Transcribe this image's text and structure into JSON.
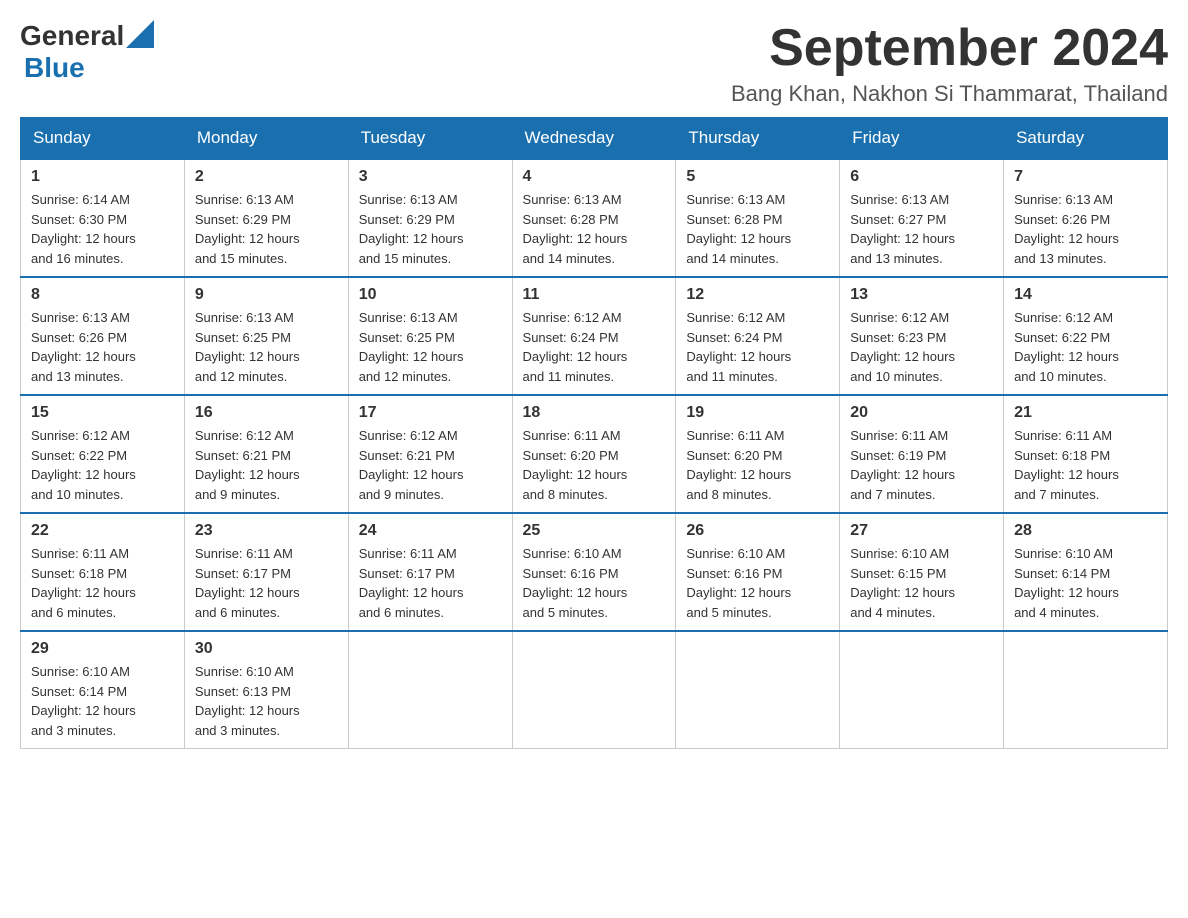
{
  "header": {
    "logo": {
      "general": "General",
      "blue": "Blue"
    },
    "title": "September 2024",
    "location": "Bang Khan, Nakhon Si Thammarat, Thailand"
  },
  "calendar": {
    "days_of_week": [
      "Sunday",
      "Monday",
      "Tuesday",
      "Wednesday",
      "Thursday",
      "Friday",
      "Saturday"
    ],
    "weeks": [
      [
        {
          "day": "1",
          "sunrise": "6:14 AM",
          "sunset": "6:30 PM",
          "daylight": "12 hours and 16 minutes."
        },
        {
          "day": "2",
          "sunrise": "6:13 AM",
          "sunset": "6:29 PM",
          "daylight": "12 hours and 15 minutes."
        },
        {
          "day": "3",
          "sunrise": "6:13 AM",
          "sunset": "6:29 PM",
          "daylight": "12 hours and 15 minutes."
        },
        {
          "day": "4",
          "sunrise": "6:13 AM",
          "sunset": "6:28 PM",
          "daylight": "12 hours and 14 minutes."
        },
        {
          "day": "5",
          "sunrise": "6:13 AM",
          "sunset": "6:28 PM",
          "daylight": "12 hours and 14 minutes."
        },
        {
          "day": "6",
          "sunrise": "6:13 AM",
          "sunset": "6:27 PM",
          "daylight": "12 hours and 13 minutes."
        },
        {
          "day": "7",
          "sunrise": "6:13 AM",
          "sunset": "6:26 PM",
          "daylight": "12 hours and 13 minutes."
        }
      ],
      [
        {
          "day": "8",
          "sunrise": "6:13 AM",
          "sunset": "6:26 PM",
          "daylight": "12 hours and 13 minutes."
        },
        {
          "day": "9",
          "sunrise": "6:13 AM",
          "sunset": "6:25 PM",
          "daylight": "12 hours and 12 minutes."
        },
        {
          "day": "10",
          "sunrise": "6:13 AM",
          "sunset": "6:25 PM",
          "daylight": "12 hours and 12 minutes."
        },
        {
          "day": "11",
          "sunrise": "6:12 AM",
          "sunset": "6:24 PM",
          "daylight": "12 hours and 11 minutes."
        },
        {
          "day": "12",
          "sunrise": "6:12 AM",
          "sunset": "6:24 PM",
          "daylight": "12 hours and 11 minutes."
        },
        {
          "day": "13",
          "sunrise": "6:12 AM",
          "sunset": "6:23 PM",
          "daylight": "12 hours and 10 minutes."
        },
        {
          "day": "14",
          "sunrise": "6:12 AM",
          "sunset": "6:22 PM",
          "daylight": "12 hours and 10 minutes."
        }
      ],
      [
        {
          "day": "15",
          "sunrise": "6:12 AM",
          "sunset": "6:22 PM",
          "daylight": "12 hours and 10 minutes."
        },
        {
          "day": "16",
          "sunrise": "6:12 AM",
          "sunset": "6:21 PM",
          "daylight": "12 hours and 9 minutes."
        },
        {
          "day": "17",
          "sunrise": "6:12 AM",
          "sunset": "6:21 PM",
          "daylight": "12 hours and 9 minutes."
        },
        {
          "day": "18",
          "sunrise": "6:11 AM",
          "sunset": "6:20 PM",
          "daylight": "12 hours and 8 minutes."
        },
        {
          "day": "19",
          "sunrise": "6:11 AM",
          "sunset": "6:20 PM",
          "daylight": "12 hours and 8 minutes."
        },
        {
          "day": "20",
          "sunrise": "6:11 AM",
          "sunset": "6:19 PM",
          "daylight": "12 hours and 7 minutes."
        },
        {
          "day": "21",
          "sunrise": "6:11 AM",
          "sunset": "6:18 PM",
          "daylight": "12 hours and 7 minutes."
        }
      ],
      [
        {
          "day": "22",
          "sunrise": "6:11 AM",
          "sunset": "6:18 PM",
          "daylight": "12 hours and 6 minutes."
        },
        {
          "day": "23",
          "sunrise": "6:11 AM",
          "sunset": "6:17 PM",
          "daylight": "12 hours and 6 minutes."
        },
        {
          "day": "24",
          "sunrise": "6:11 AM",
          "sunset": "6:17 PM",
          "daylight": "12 hours and 6 minutes."
        },
        {
          "day": "25",
          "sunrise": "6:10 AM",
          "sunset": "6:16 PM",
          "daylight": "12 hours and 5 minutes."
        },
        {
          "day": "26",
          "sunrise": "6:10 AM",
          "sunset": "6:16 PM",
          "daylight": "12 hours and 5 minutes."
        },
        {
          "day": "27",
          "sunrise": "6:10 AM",
          "sunset": "6:15 PM",
          "daylight": "12 hours and 4 minutes."
        },
        {
          "day": "28",
          "sunrise": "6:10 AM",
          "sunset": "6:14 PM",
          "daylight": "12 hours and 4 minutes."
        }
      ],
      [
        {
          "day": "29",
          "sunrise": "6:10 AM",
          "sunset": "6:14 PM",
          "daylight": "12 hours and 3 minutes."
        },
        {
          "day": "30",
          "sunrise": "6:10 AM",
          "sunset": "6:13 PM",
          "daylight": "12 hours and 3 minutes."
        },
        null,
        null,
        null,
        null,
        null
      ]
    ],
    "labels": {
      "sunrise": "Sunrise:",
      "sunset": "Sunset:",
      "daylight": "Daylight:"
    }
  }
}
